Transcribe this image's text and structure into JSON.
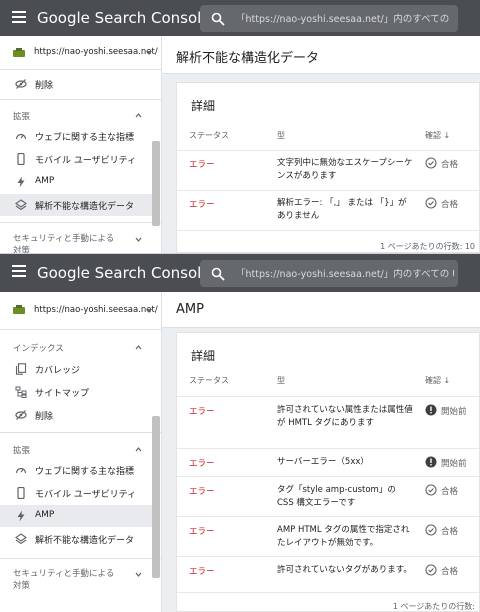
{
  "app": {
    "title": "Google Search Console"
  },
  "search": {
    "placeholder": "「https://nao-yoshi.seesaa.net/」内のすべての"
  },
  "search2": {
    "placeholder": "「https://nao-yoshi.seesaa.net/」内のすべての U"
  },
  "property": {
    "url": "https://nao-yoshi.seesaa.net/"
  },
  "shot1": {
    "page_title": "解析不能な構造化データ",
    "sidebar": {
      "top_item": "削除",
      "section_enhancements": "拡張",
      "items": [
        "ウェブに関する主な指標",
        "モバイル ユーザビリティ",
        "AMP",
        "解析不能な構造化データ"
      ],
      "section_security": "セキュリティと手動による",
      "section_security_2": "対策"
    },
    "card": {
      "title": "詳細",
      "headers": {
        "status": "ステータス",
        "type": "型",
        "validation": "確認"
      },
      "rows": [
        {
          "status": "エラー",
          "type": "文字列中に無効なエスケープシーケンスがあります",
          "validation": "合格"
        },
        {
          "status": "エラー",
          "type": "解析エラー: 「,」 または 「}」がありません",
          "validation": "合格"
        }
      ],
      "footer": "1 ページあたりの行数:",
      "footer_value": "10"
    }
  },
  "shot2": {
    "page_title": "AMP",
    "sidebar": {
      "section_index": "インデックス",
      "index_items": [
        "カバレッジ",
        "サイトマップ",
        "削除"
      ],
      "section_enhancements": "拡張",
      "items": [
        "ウェブに関する主な指標",
        "モバイル ユーザビリティ",
        "AMP",
        "解析不能な構造化データ"
      ],
      "section_security": "セキュリティと手動による",
      "section_security_2": "対策"
    },
    "card": {
      "title": "詳細",
      "headers": {
        "status": "ステータス",
        "type": "型",
        "validation": "確認"
      },
      "rows": [
        {
          "status": "エラー",
          "type": "許可されていない属性または属性値が HMTL タグにあります",
          "validation": "開始前",
          "kind": "pending"
        },
        {
          "status": "エラー",
          "type": "サーバーエラー（5xx）",
          "validation": "開始前",
          "kind": "pending"
        },
        {
          "status": "エラー",
          "type": "タグ「style amp-custom」の CSS 構文エラーです",
          "validation": "合格",
          "kind": "passed"
        },
        {
          "status": "エラー",
          "type": "AMP HTML タグの属性で指定されたレイアウトが無効です。",
          "validation": "合格",
          "kind": "passed"
        },
        {
          "status": "エラー",
          "type": "許可されていないタグがあります。",
          "validation": "合格",
          "kind": "passed"
        }
      ],
      "footer": "1 ページあたりの行数:"
    }
  },
  "colors": {
    "header": "#4a4d52",
    "error": "#c5221f",
    "active_item": "#e8eaed"
  }
}
